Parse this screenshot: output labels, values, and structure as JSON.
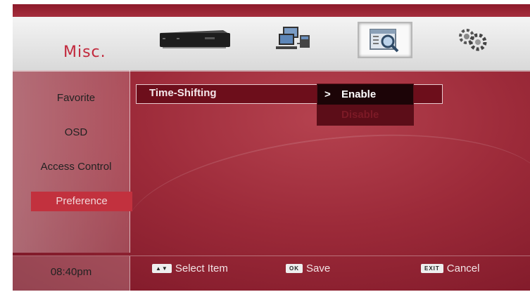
{
  "header": {
    "title": "Misc.",
    "icons": [
      "set-top-box-icon",
      "network-computer-icon",
      "search-window-icon",
      "gears-icon"
    ],
    "selected_icon": "search-window-icon"
  },
  "sidebar": {
    "items": [
      {
        "label": "Favorite"
      },
      {
        "label": "OSD"
      },
      {
        "label": "Access Control"
      },
      {
        "label": "Preference"
      }
    ],
    "active": "Preference"
  },
  "content": {
    "row_label": "Time-Shifting",
    "options": [
      {
        "marker": ">",
        "label": "Enable"
      },
      {
        "marker": "",
        "label": "Disable"
      }
    ],
    "selected_option": "Enable"
  },
  "footer": {
    "time": "08:40pm",
    "hints": [
      {
        "key": "▲▼",
        "label": "Select Item"
      },
      {
        "key": "OK",
        "label": "Save"
      },
      {
        "key": "EXIT",
        "label": "Cancel"
      }
    ]
  },
  "colors": {
    "background": "#9c2a39",
    "accent": "#c2313e",
    "header_bar": "#e8e8e8",
    "title": "#c2283c"
  }
}
